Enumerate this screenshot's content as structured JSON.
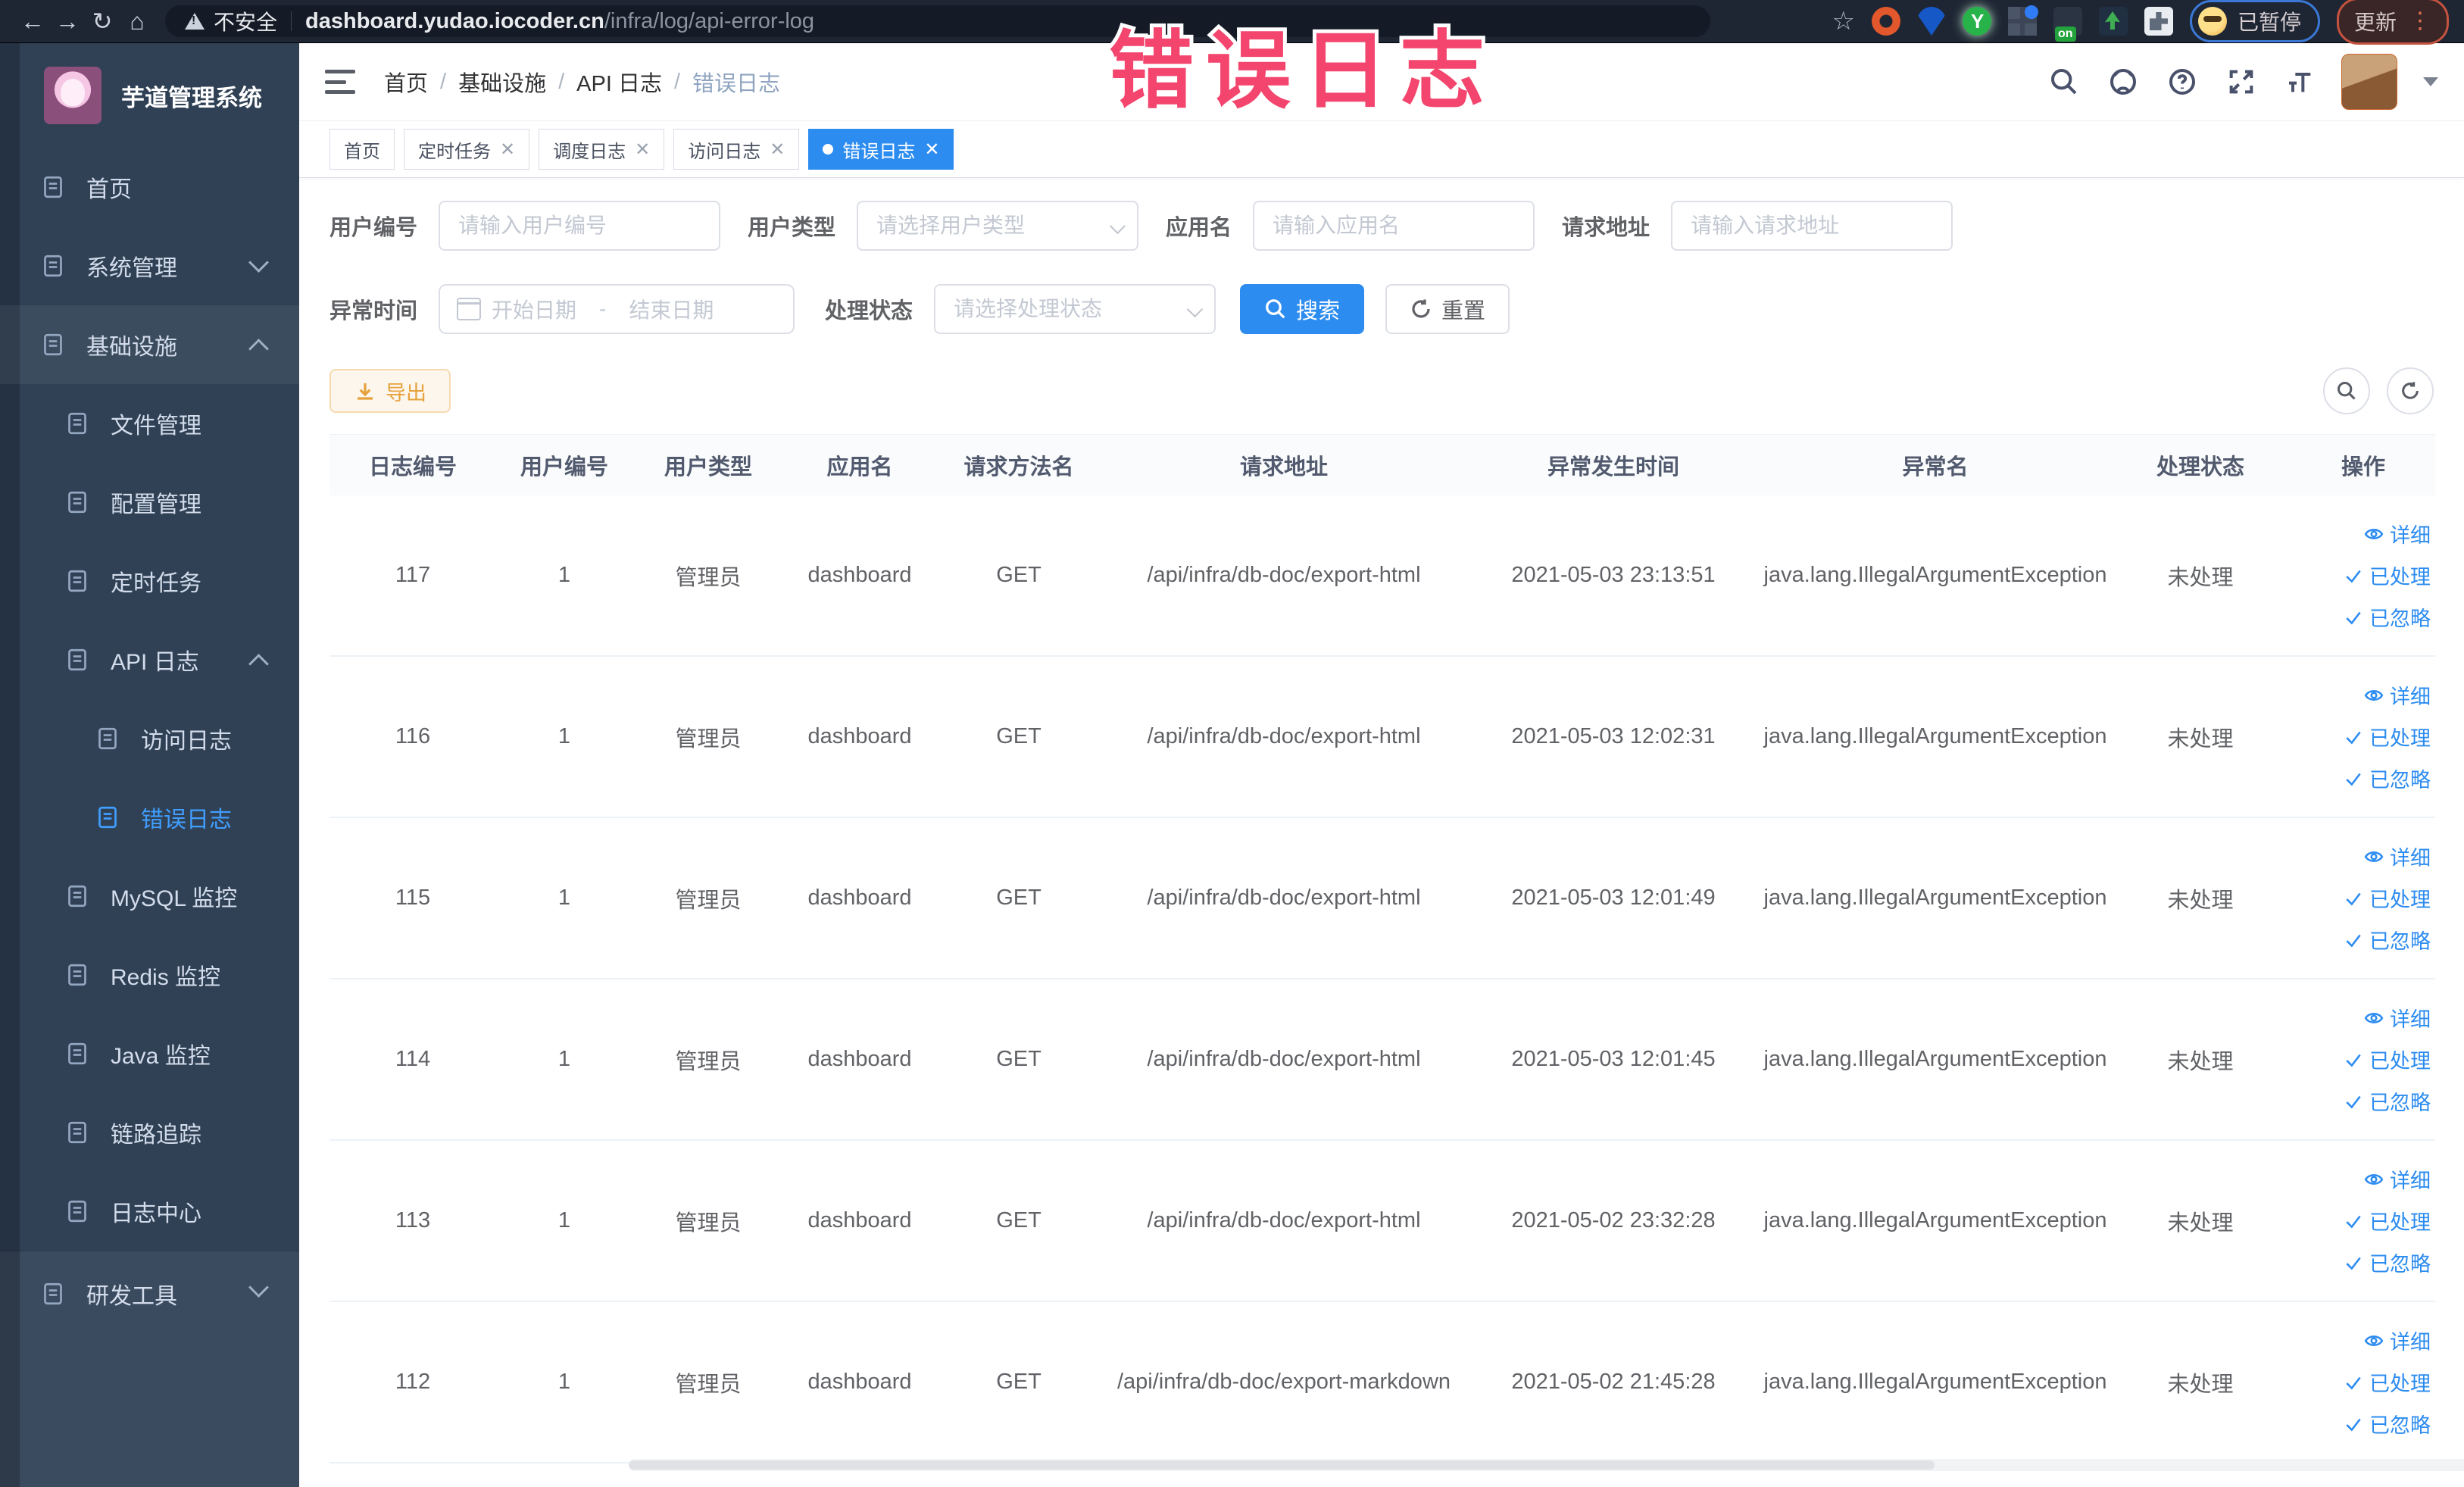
{
  "browser": {
    "security_label": "不安全",
    "url_domain": "dashboard.yudao.iocoder.cn",
    "url_path": "/infra/log/api-error-log",
    "paused_label": "已暂停",
    "update_label": "更新"
  },
  "overlay": {
    "text": "错误日志",
    "color": "#f3456d"
  },
  "sidebar": {
    "title": "芋道管理系统",
    "items": [
      {
        "label": "首页",
        "icon": "home-icon",
        "level": 1
      },
      {
        "label": "系统管理",
        "icon": "gear-icon",
        "level": 1,
        "chevron": "down"
      },
      {
        "label": "基础设施",
        "icon": "monitor-icon",
        "level": 1,
        "chevron": "up",
        "open": true
      },
      {
        "label": "文件管理",
        "icon": "file-upload-icon",
        "level": 2
      },
      {
        "label": "配置管理",
        "icon": "config-edit-icon",
        "level": 2
      },
      {
        "label": "定时任务",
        "icon": "timer-icon",
        "level": 2
      },
      {
        "label": "API 日志",
        "icon": "api-log-icon",
        "level": 2,
        "chevron": "up"
      },
      {
        "label": "访问日志",
        "icon": "access-log-icon",
        "level": 3
      },
      {
        "label": "错误日志",
        "icon": "error-log-icon",
        "level": 3,
        "active": true
      },
      {
        "label": "MySQL 监控",
        "icon": "mysql-monitor-icon",
        "level": 2
      },
      {
        "label": "Redis 监控",
        "icon": "redis-monitor-icon",
        "level": 2
      },
      {
        "label": "Java 监控",
        "icon": "java-monitor-icon",
        "level": 2
      },
      {
        "label": "链路追踪",
        "icon": "trace-icon",
        "level": 2
      },
      {
        "label": "日志中心",
        "icon": "log-center-icon",
        "level": 2
      }
    ],
    "bottom_items": [
      {
        "label": "研发工具",
        "icon": "dev-tools-icon",
        "level": 1,
        "chevron": "down"
      }
    ]
  },
  "breadcrumb": {
    "separator": "/",
    "items": [
      "首页",
      "基础设施",
      "API 日志",
      "错误日志"
    ]
  },
  "tabs": [
    {
      "label": "首页",
      "closable": false,
      "active": false
    },
    {
      "label": "定时任务",
      "closable": true,
      "active": false
    },
    {
      "label": "调度日志",
      "closable": true,
      "active": false
    },
    {
      "label": "访问日志",
      "closable": true,
      "active": false
    },
    {
      "label": "错误日志",
      "closable": true,
      "active": true
    }
  ],
  "filters": {
    "user_id": {
      "label": "用户编号",
      "placeholder": "请输入用户编号"
    },
    "user_type": {
      "label": "用户类型",
      "placeholder": "请选择用户类型"
    },
    "app_name": {
      "label": "应用名",
      "placeholder": "请输入应用名"
    },
    "request_url": {
      "label": "请求地址",
      "placeholder": "请输入请求地址"
    },
    "exception_time": {
      "label": "异常时间",
      "start_placeholder": "开始日期",
      "separator": "-",
      "end_placeholder": "结束日期"
    },
    "process_status": {
      "label": "处理状态",
      "placeholder": "请选择处理状态"
    },
    "search_label": "搜索",
    "reset_label": "重置"
  },
  "toolbar": {
    "export_label": "导出"
  },
  "table": {
    "headers": [
      "日志编号",
      "用户编号",
      "用户类型",
      "应用名",
      "请求方法名",
      "请求地址",
      "异常发生时间",
      "异常名",
      "处理状态",
      "操作"
    ],
    "actions": [
      "详细",
      "已处理",
      "已忽略"
    ],
    "rows": [
      {
        "log_id": "117",
        "user_id": "1",
        "user_type": "管理员",
        "app_name": "dashboard",
        "method": "GET",
        "url": "/api/infra/db-doc/export-html",
        "time": "2021-05-03 23:13:51",
        "exception": "java.lang.IllegalArgumentException",
        "status": "未处理"
      },
      {
        "log_id": "116",
        "user_id": "1",
        "user_type": "管理员",
        "app_name": "dashboard",
        "method": "GET",
        "url": "/api/infra/db-doc/export-html",
        "time": "2021-05-03 12:02:31",
        "exception": "java.lang.IllegalArgumentException",
        "status": "未处理"
      },
      {
        "log_id": "115",
        "user_id": "1",
        "user_type": "管理员",
        "app_name": "dashboard",
        "method": "GET",
        "url": "/api/infra/db-doc/export-html",
        "time": "2021-05-03 12:01:49",
        "exception": "java.lang.IllegalArgumentException",
        "status": "未处理"
      },
      {
        "log_id": "114",
        "user_id": "1",
        "user_type": "管理员",
        "app_name": "dashboard",
        "method": "GET",
        "url": "/api/infra/db-doc/export-html",
        "time": "2021-05-03 12:01:45",
        "exception": "java.lang.IllegalArgumentException",
        "status": "未处理"
      },
      {
        "log_id": "113",
        "user_id": "1",
        "user_type": "管理员",
        "app_name": "dashboard",
        "method": "GET",
        "url": "/api/infra/db-doc/export-html",
        "time": "2021-05-02 23:32:28",
        "exception": "java.lang.IllegalArgumentException",
        "status": "未处理"
      },
      {
        "log_id": "112",
        "user_id": "1",
        "user_type": "管理员",
        "app_name": "dashboard",
        "method": "GET",
        "url": "/api/infra/db-doc/export-markdown",
        "time": "2021-05-02 21:45:28",
        "exception": "java.lang.IllegalArgumentException",
        "status": "未处理"
      }
    ]
  }
}
